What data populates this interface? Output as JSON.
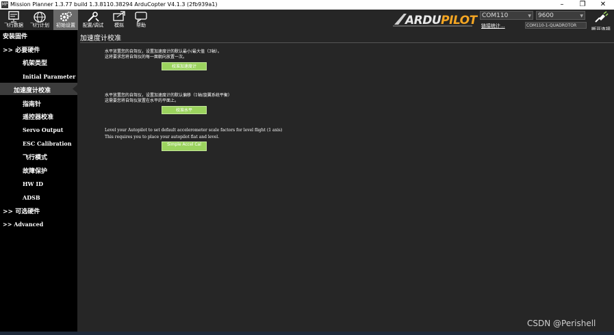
{
  "window": {
    "title": "Mission Planner 1.3.77 build 1.3.8110.38294 ArduCopter V4.1.3 (2fb939a1)",
    "app_icon": "MP",
    "minimize": "–",
    "maximize": "❐",
    "close": "✕"
  },
  "toolbar": {
    "items": [
      {
        "label": "飞行数据",
        "icon": "monitor-icon"
      },
      {
        "label": "飞行计划",
        "icon": "globe-icon"
      },
      {
        "label": "初始设置",
        "icon": "gear-icon"
      },
      {
        "label": "配置/调试",
        "icon": "wrench-icon"
      },
      {
        "label": "模拟",
        "icon": "simulation-icon"
      },
      {
        "label": "帮助",
        "icon": "help-icon"
      }
    ],
    "logo_text": "ARDUPILOT",
    "port": "COM110",
    "baud": "9600",
    "link_stats": "链接统计...",
    "profile": "COM110-1-QUADROTOR",
    "connect_label": "断开连接"
  },
  "sidebar": {
    "header": "安装固件",
    "items": [
      {
        "label": ">> 必要硬件"
      },
      {
        "label": "机架类型"
      },
      {
        "label": "Initial Parameter Setup"
      },
      {
        "label": "加速度计校准"
      },
      {
        "label": "指南针"
      },
      {
        "label": "遥控器校准"
      },
      {
        "label": "Servo Output"
      },
      {
        "label": "ESC Calibration"
      },
      {
        "label": "飞行模式"
      },
      {
        "label": "故障保护"
      },
      {
        "label": "HW ID"
      },
      {
        "label": "ADSB"
      },
      {
        "label": ">> 可选硬件"
      },
      {
        "label": ">> Advanced"
      }
    ]
  },
  "main": {
    "title": "加速度计校准",
    "sections": [
      {
        "line1": "水平放置您的自驾仪，设置加速度计的默认最小/最大值（3轴）。",
        "line2": "这将要求您将自驾仪的每一面朝向放置一次。",
        "button": "校准加速度计"
      },
      {
        "line1": "水平放置您的自驾仪，设置加速度计的默认偏移（1轴/旋翼系统平衡）",
        "line2": "这需要您将自驾仪放置在水平的平面上。",
        "button": "校准水平"
      },
      {
        "line1": "Level your Autopilot to set default accelerometer scale factors for level flight (1 axis)",
        "line2": "This requires you to place your autopilot flat and level.",
        "button": "Simple Accel Cal"
      }
    ]
  },
  "watermark": "CSDN @Perishell",
  "colors": {
    "background": "#262626",
    "sidebar": "#000000",
    "button": "#9bd35e",
    "logo_accent": "#f5a623"
  }
}
